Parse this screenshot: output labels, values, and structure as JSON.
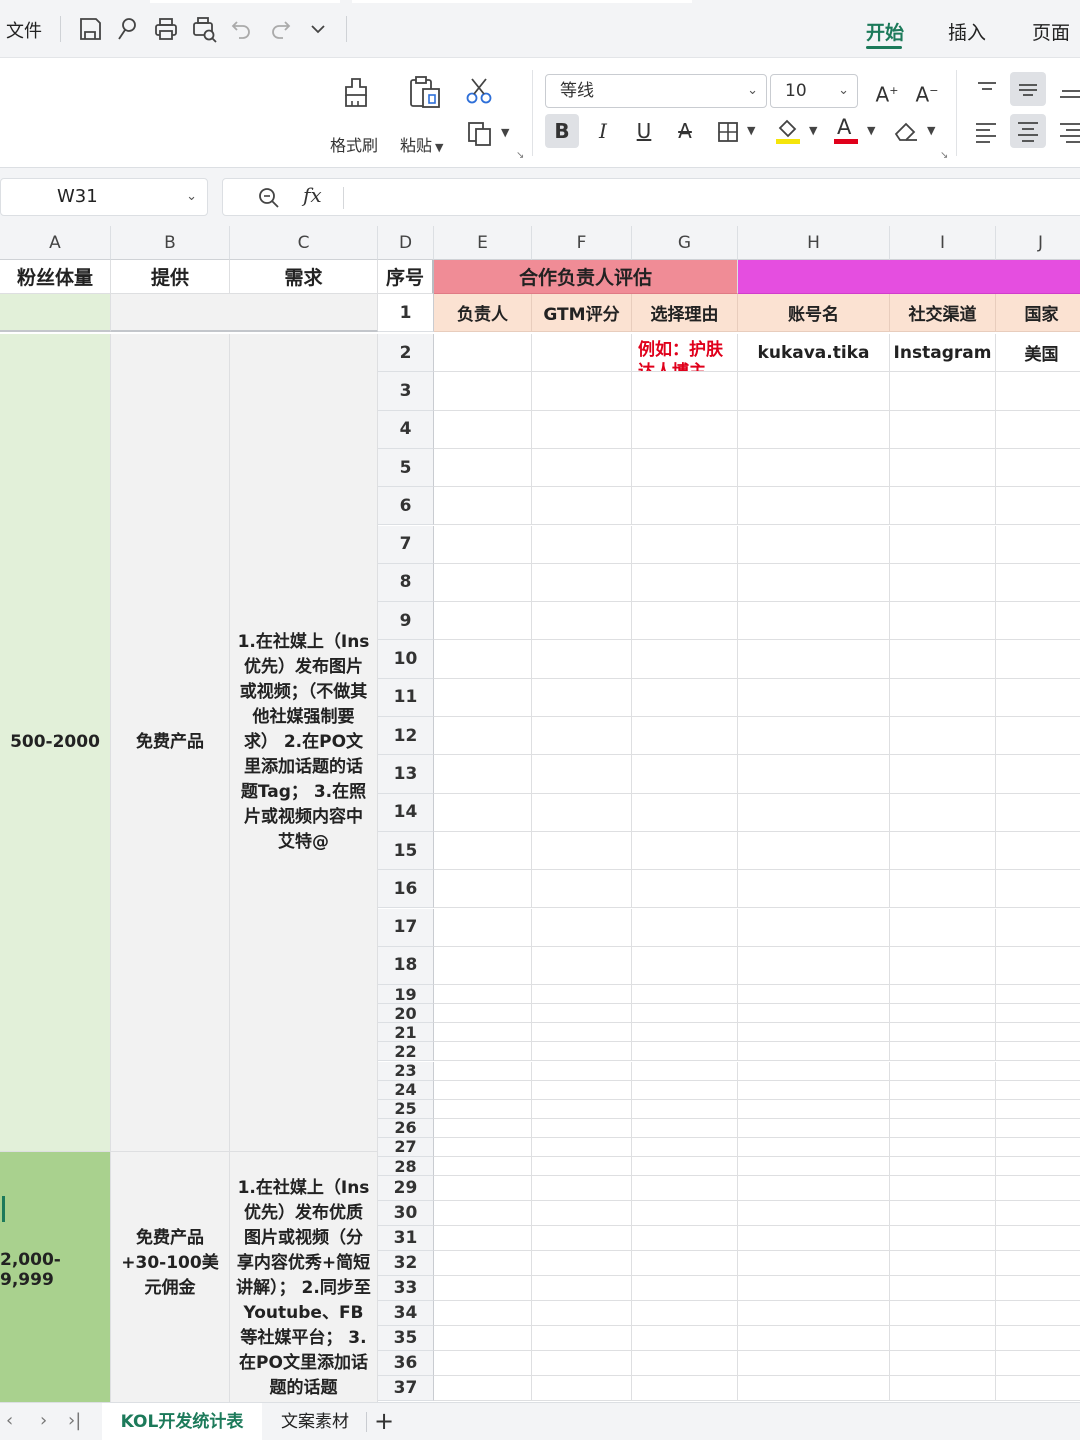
{
  "menubar": {
    "file_label": "文件",
    "tabs": [
      {
        "label": "开始",
        "active": true
      },
      {
        "label": "插入",
        "active": false
      },
      {
        "label": "页面",
        "active": false
      }
    ],
    "quick_icons": [
      "save-icon",
      "find-icon",
      "print-icon",
      "print-preview-icon",
      "undo-icon",
      "redo-icon",
      "more-chevron-icon"
    ]
  },
  "ribbon": {
    "format_painter_label": "格式刷",
    "paste_label": "粘贴",
    "font_name": "等线",
    "font_size": "10",
    "bold": "B",
    "italic": "I",
    "underline": "U",
    "strike": "A",
    "font_color_letter": "A",
    "grow_font": "A",
    "shrink_font": "A"
  },
  "formula_bar": {
    "cell_ref": "W31",
    "fx_label": "fx",
    "formula": ""
  },
  "columns": [
    "A",
    "B",
    "C",
    "D",
    "E",
    "F",
    "G",
    "H",
    "I",
    "J"
  ],
  "header_row": {
    "a": "粉丝体量",
    "b": "提供",
    "c": "需求",
    "d": "序号",
    "eval_group": "合作负责人评估"
  },
  "sub_header_row": {
    "seq": "1",
    "e": "负责人",
    "f": "GTM评分",
    "g": "选择理由",
    "h": "账号名",
    "i": "社交渠道",
    "j": "国家"
  },
  "row_numbers": [
    "2",
    "3",
    "4",
    "5",
    "6",
    "7",
    "8",
    "9",
    "10",
    "11",
    "12",
    "13",
    "14",
    "15",
    "16",
    "17",
    "18",
    "19",
    "20",
    "21",
    "22",
    "23",
    "24",
    "25",
    "26",
    "27",
    "28",
    "29",
    "30",
    "31",
    "32",
    "33",
    "34",
    "35",
    "36",
    "37"
  ],
  "data_row_2": {
    "g": "例如：护肤达人博主",
    "h": "kukava.tika",
    "i": "Instagram",
    "j": "美国"
  },
  "tier1": {
    "fans": "500-2000",
    "offer": "免费产品",
    "need": "1.在社媒上（Ins优先）发布图片或视频；（不做其他社媒强制要求） 2.在PO文里添加话题的话题Tag； 3.在照片或视频内容中艾特@"
  },
  "tier2": {
    "fans": "2,000-9,999",
    "offer": "免费产品+30-100美元佣金",
    "need": "1.在社媒上（Ins优先）发布优质图片或视频（分享内容优秀+简短讲解）； 2.同步至Youtube、FB等社媒平台； 3.在PO文里添加话题的话题"
  },
  "colors": {
    "accent_green": "#1c7a5a",
    "tier1_fill": "#e2f0d9",
    "tier2_fill": "#a9d18e",
    "eval_header_fill": "#f08c96",
    "magenta_header_fill": "#e54ee0",
    "subheader_fill": "#fbe2d2",
    "example_red": "#e0001b"
  },
  "sheets": [
    {
      "label": "KOL开发统计表",
      "active": true
    },
    {
      "label": "文案素材",
      "active": false
    }
  ]
}
